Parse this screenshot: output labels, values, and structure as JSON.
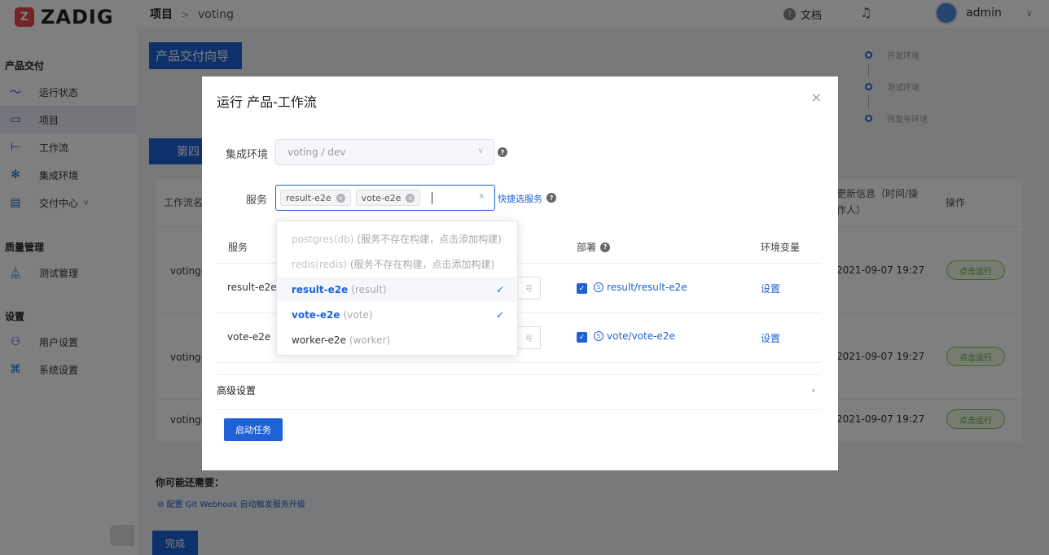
{
  "app": {
    "logo_mark": "Z",
    "logo_text": "ZADIG"
  },
  "sidebar": {
    "groups": [
      {
        "title": "产品交付",
        "items": [
          {
            "label": "运行状态",
            "icon": "pulse-icon"
          },
          {
            "label": "项目",
            "icon": "folder-icon"
          },
          {
            "label": "工作流",
            "icon": "workflow-icon"
          },
          {
            "label": "集成环境",
            "icon": "cluster-icon"
          },
          {
            "label": "交付中心",
            "icon": "delivery-icon",
            "chevron": "∨"
          }
        ]
      },
      {
        "title": "质量管理",
        "items": [
          {
            "label": "测试管理",
            "icon": "flask-icon"
          }
        ]
      },
      {
        "title": "设置",
        "items": [
          {
            "label": "用户设置",
            "icon": "user-settings-icon"
          },
          {
            "label": "系统设置",
            "icon": "system-settings-icon"
          }
        ]
      }
    ]
  },
  "topbar": {
    "breadcrumb": [
      "项目",
      "voting"
    ],
    "breadcrumb_sep": ">",
    "doc_label": "文档",
    "user_name": "admin"
  },
  "background": {
    "title_button": "产品交付向导",
    "tab_label": "第四",
    "steps": [
      "开发环境",
      "测试环境",
      "预发布环境"
    ],
    "table": {
      "col_name": "工作流名",
      "col_update": "更新信息（时间/操作人）",
      "col_update_line2": "作人）",
      "col_update_line1": "更新信息（时间/操",
      "col_action": "操作",
      "rows": [
        {
          "name": "voting-",
          "time": "2021-09-07 19:27",
          "action": "点击运行"
        },
        {
          "name": "voting-",
          "time": "2021-09-07 19:27",
          "action": "点击运行"
        },
        {
          "name": "voting-",
          "time": "2021-09-07 19:27",
          "action": "点击运行"
        }
      ]
    },
    "tips_title": "你可能还需要：",
    "tips_link": "配置 Git Webhook 自动触发服务升级",
    "finish_button": "完成"
  },
  "modal": {
    "title": "运行 产品-工作流",
    "close_icon": "×",
    "env_label": "集成环境",
    "env_value": "voting / dev",
    "service_label": "服务",
    "selected_tags": [
      "result-e2e",
      "vote-e2e"
    ],
    "quick_select": "快捷选服务",
    "table": {
      "col_service": "服务",
      "col_deploy": "部署",
      "col_env": "环境变量",
      "rows": [
        {
          "service": "result-e2e",
          "input_hint": "号",
          "deploy": "result/result-e2e",
          "env_action": "设置"
        },
        {
          "service": "vote-e2e",
          "input_hint": "号",
          "deploy": "vote/vote-e2e",
          "env_action": "设置"
        }
      ]
    },
    "advanced": "高级设置",
    "start_button": "启动任务",
    "dropdown": [
      {
        "name": "postgres(db)",
        "sub": " (服务不存在构建，点击添加构建)",
        "state": "disabled"
      },
      {
        "name": "redis(redis)",
        "sub": " (服务不存在构建，点击添加构建)",
        "state": "disabled"
      },
      {
        "name": "result-e2e",
        "sub": "(result)",
        "state": "selected"
      },
      {
        "name": "vote-e2e",
        "sub": "(vote)",
        "state": "selected"
      },
      {
        "name": "worker-e2e",
        "sub": "(worker)",
        "state": "normal"
      }
    ]
  },
  "colors": {
    "primary": "#1f62d6",
    "success": "#56a93b",
    "logo": "#e5484d"
  }
}
